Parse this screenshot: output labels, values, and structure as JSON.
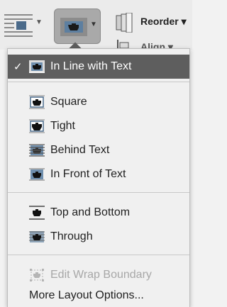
{
  "ribbon": {
    "reorder_label": "Reorder ▾",
    "align_label": "Align ▾"
  },
  "menu": {
    "selected_check": "✓",
    "items": [
      {
        "label": "In Line with Text",
        "icon": "inline-wrap-icon"
      },
      {
        "label": "Square",
        "icon": "square-wrap-icon"
      },
      {
        "label": "Tight",
        "icon": "tight-wrap-icon"
      },
      {
        "label": "Behind Text",
        "icon": "behind-text-icon"
      },
      {
        "label": "In Front of Text",
        "icon": "in-front-of-text-icon"
      },
      {
        "label": "Top and Bottom",
        "icon": "top-bottom-wrap-icon"
      },
      {
        "label": "Through",
        "icon": "through-wrap-icon"
      },
      {
        "label": "Edit Wrap Boundary",
        "icon": "edit-wrap-boundary-icon"
      },
      {
        "label": "More Layout Options...",
        "icon": ""
      }
    ]
  },
  "colors": {
    "selected_bg": "#5e5e5e",
    "disabled_text": "#a7a7a7"
  }
}
